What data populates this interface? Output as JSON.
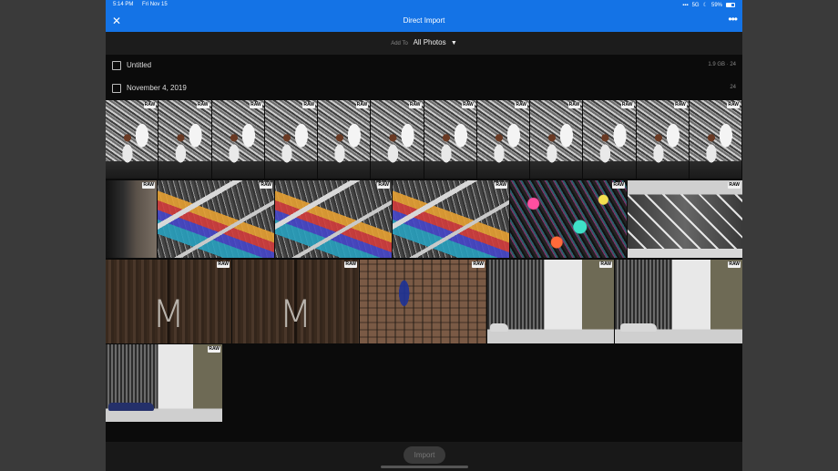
{
  "status_bar": {
    "time": "5:14 PM",
    "date": "Fri Nov 15",
    "network": "5G",
    "battery": "59%",
    "battery_level": 0.59
  },
  "header": {
    "title": "Direct Import",
    "close_icon": "close-icon",
    "more_icon": "more-icon"
  },
  "add_to": {
    "label": "Add To",
    "value": "All Photos"
  },
  "groups": [
    {
      "name": "Untitled",
      "meta": "1.9 GB · 24"
    },
    {
      "name": "November 4, 2019",
      "meta": "24"
    }
  ],
  "raw_badge": "RAW",
  "thumbnails": {
    "row1_count": 12,
    "row2": 7,
    "row3": 5,
    "row4": 1
  },
  "door_letter": "M",
  "footer": {
    "import_label": "Import"
  },
  "colors": {
    "accent": "#1473e6",
    "background": "#0b0b0b"
  }
}
